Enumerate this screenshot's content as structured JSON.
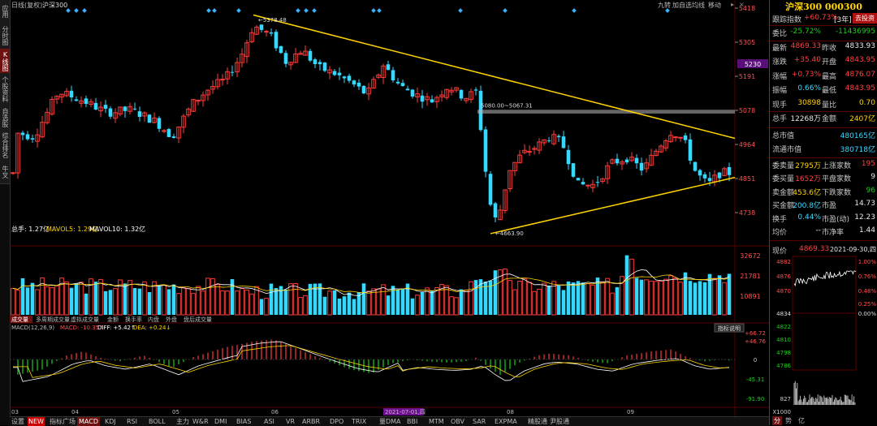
{
  "left_nav": [
    {
      "label": "应用",
      "active": false
    },
    {
      "label": "分时图",
      "active": false
    },
    {
      "label": "K线图",
      "active": true
    },
    {
      "label": "个股资料",
      "active": false
    },
    {
      "label": "自选股",
      "active": false
    },
    {
      "label": "综合排名",
      "active": false
    },
    {
      "label": "牛叉",
      "active": false
    }
  ],
  "header": {
    "period": "日线(复权)",
    "instrument": "沪深300",
    "right_tools": [
      "九转",
      "加自选",
      "均线",
      "移动"
    ]
  },
  "colors": {
    "up": "#ff3a3a",
    "down": "#35d8ff",
    "trend": "#ffd400",
    "ma5": "#ffffff",
    "ma10": "#ffd400",
    "hline": "#b8b8b8"
  },
  "price_axis": {
    "ticks": [
      "5418",
      "5305",
      "5191",
      "5078",
      "4964",
      "4851",
      "4738"
    ],
    "current": "5230"
  },
  "annotations": {
    "high": "5378.48",
    "low": "4663.90",
    "hline": "5080.00~5067.31"
  },
  "volume": {
    "label_total": "总手: 1.27亿",
    "label_ma5": "MAVOL5: 1.29亿",
    "label_ma10": "MAVOL10: 1.32亿",
    "axis": [
      "32672",
      "21781",
      "10891"
    ]
  },
  "volume_tabs": [
    "成交量",
    "多周期成交量",
    "虚拟成交量",
    "金额",
    "换手率",
    "内盘",
    "外盘",
    "盘后成交量"
  ],
  "macd": {
    "label": "MACD(12,26,9)",
    "macd": "MACD: -10.35↑",
    "diff": "DIFF: +5.42↑",
    "dea": "DEA: +0.24↓",
    "axis": [
      "+66.72",
      "+46.76",
      "0",
      "-45.31",
      "-91.90"
    ],
    "help": "指标说明"
  },
  "x_axis": {
    "labels": [
      "03",
      "04",
      "05",
      "06",
      "2021-07-01,四",
      "08",
      "09"
    ]
  },
  "bottom_tabs": [
    "设置",
    "NEW",
    "指标广场",
    "MACD",
    "KDJ",
    "RSI",
    "BOLL",
    "主力",
    "W&R",
    "DMI",
    "BIAS",
    "ASI",
    "VR",
    "ARBR",
    "DPO",
    "TRIX",
    "量DMA",
    "BBI",
    "MTM",
    "OBV",
    "SAR",
    "EXPMA",
    "精股通",
    "尹股通"
  ],
  "panel": {
    "title": "沪深300 000300",
    "tracking": "跟踪指数",
    "tracking_val": "+60.73%",
    "tracking_tag": "[3年]",
    "buy_btn": "去投资",
    "rows": [
      {
        "l1": "委比",
        "v1": "-25.72%",
        "c1": "grn",
        "l2": "",
        "v2": "-11436995",
        "c2": "grn"
      },
      {
        "l1": "最新",
        "v1": "4869.33",
        "c1": "red",
        "l2": "昨收",
        "v2": "4833.93",
        "c2": "wht"
      },
      {
        "l1": "涨跌",
        "v1": "+35.40",
        "c1": "red",
        "l2": "开盘",
        "v2": "4843.95",
        "c2": "red"
      },
      {
        "l1": "涨幅",
        "v1": "+0.73%",
        "c1": "red",
        "l2": "最高",
        "v2": "4876.07",
        "c2": "red"
      },
      {
        "l1": "振幅",
        "v1": "0.66%",
        "c1": "cyan",
        "l2": "最低",
        "v2": "4843.95",
        "c2": "red"
      },
      {
        "l1": "现手",
        "v1": "30898",
        "c1": "yel",
        "l2": "量比",
        "v2": "0.70",
        "c2": "yel"
      },
      {
        "l1": "总手",
        "v1": "12268万",
        "c1": "wht",
        "l2": "金额",
        "v2": "2407亿",
        "c2": "yel"
      }
    ],
    "rows2": [
      {
        "l1": "总市值",
        "v1": "480165亿",
        "c1": "cyan"
      },
      {
        "l1": "流通市值",
        "v1": "380718亿",
        "c1": "cyan"
      }
    ],
    "rows3": [
      {
        "l1": "委卖量",
        "v1": "2795万",
        "c1": "yel",
        "l2": "上涨家数",
        "v2": "195",
        "c2": "red"
      },
      {
        "l1": "委买量",
        "v1": "1652万",
        "c1": "red",
        "l2": "平盘家数",
        "v2": "9",
        "c2": "wht"
      },
      {
        "l1": "卖金额",
        "v1": "453.6亿",
        "c1": "yel",
        "l2": "下跌家数",
        "v2": "96",
        "c2": "grn"
      },
      {
        "l1": "买金额",
        "v1": "200.8亿",
        "c1": "cyan",
        "l2": "市盈",
        "v2": "14.73",
        "c2": "wht"
      },
      {
        "l1": "换手",
        "v1": "0.44%",
        "c1": "cyan",
        "l2": "市盈(动)",
        "v2": "12.23",
        "c2": "wht"
      },
      {
        "l1": "均价",
        "v1": "--",
        "c1": "wht",
        "l2": "市净率",
        "v2": "1.44",
        "c2": "wht"
      }
    ],
    "mini": {
      "label": "现价",
      "price": "4869.33",
      "date": "2021-09-30,四",
      "left_axis": [
        "4882",
        "4876",
        "4870",
        "4834",
        "4822",
        "4810",
        "4798",
        "4786"
      ],
      "right_axis": [
        "1.00%",
        "0.76%",
        "0.48%",
        "0.25%",
        "0.00%"
      ],
      "vol_axis": [
        "827",
        "X1000"
      ]
    },
    "bottom_tabs": [
      "分",
      "势",
      "亿"
    ]
  },
  "chart_data": {
    "type": "candlestick",
    "title": "沪深300",
    "period": "daily",
    "x_range": [
      "2021-02-26",
      "2021-09-30"
    ],
    "y_ticks": [
      5418,
      5305,
      5191,
      5078,
      4964,
      4851,
      4738
    ],
    "annotated_high": 5378.48,
    "annotated_low": 4663.9,
    "horizontal_line": [
      5080.0,
      5067.31
    ],
    "last_close": 4869.33,
    "trendlines": [
      {
        "name": "upper",
        "from": {
          "date": "2021-05-28",
          "price": 5378.48
        },
        "to": {
          "date": "2021-09-30",
          "price": 4980
        }
      },
      {
        "name": "lower",
        "from": {
          "date": "2021-07-28",
          "price": 4663.9
        },
        "to": {
          "date": "2021-09-30",
          "price": 4860
        }
      }
    ],
    "volume_axis": [
      32672,
      21781,
      10891
    ],
    "macd_axis": [
      66.72,
      46.76,
      0,
      -45.31,
      -91.9
    ],
    "macd_last": {
      "MACD": -10.35,
      "DIFF": 5.42,
      "DEA": 0.24
    }
  }
}
